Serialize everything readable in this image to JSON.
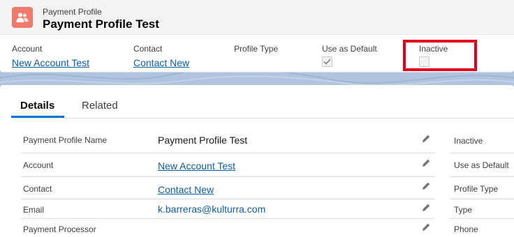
{
  "header": {
    "object_label": "Payment Profile",
    "record_title": "Payment Profile Test",
    "fields": [
      {
        "label": "Account",
        "value": "New Account Test"
      },
      {
        "label": "Contact",
        "value": "Contact New"
      },
      {
        "label": "Profile Type",
        "value": ""
      },
      {
        "label": "Use as Default",
        "checked": true
      },
      {
        "label": "Inactive",
        "checked": false
      }
    ]
  },
  "tabs": [
    {
      "label": "Details",
      "active": true
    },
    {
      "label": "Related",
      "active": false
    }
  ],
  "details_left": [
    {
      "label": "Payment Profile Name",
      "value": "Payment Profile Test",
      "link": false
    },
    {
      "label": "Account",
      "value": "New Account Test",
      "link": true
    },
    {
      "label": "Contact",
      "value": "Contact New",
      "link": true
    },
    {
      "label": "Email",
      "value": "k.barreras@kulturra.com",
      "link": true
    },
    {
      "label": "Payment Processor",
      "value": "",
      "link": false
    }
  ],
  "details_right": [
    {
      "label": "Inactive"
    },
    {
      "label": "Use as Default"
    },
    {
      "label": "Profile Type"
    },
    {
      "label": "Type"
    },
    {
      "label": "Phone"
    }
  ],
  "colors": {
    "brand_icon": "#f07a6b",
    "link": "#0b5cab",
    "tab_active": "#0176d3",
    "highlight": "#e3001b"
  },
  "icons": {
    "object": "payment-profile-people-icon",
    "edit": "pencil-icon",
    "check": "checkmark-icon"
  }
}
